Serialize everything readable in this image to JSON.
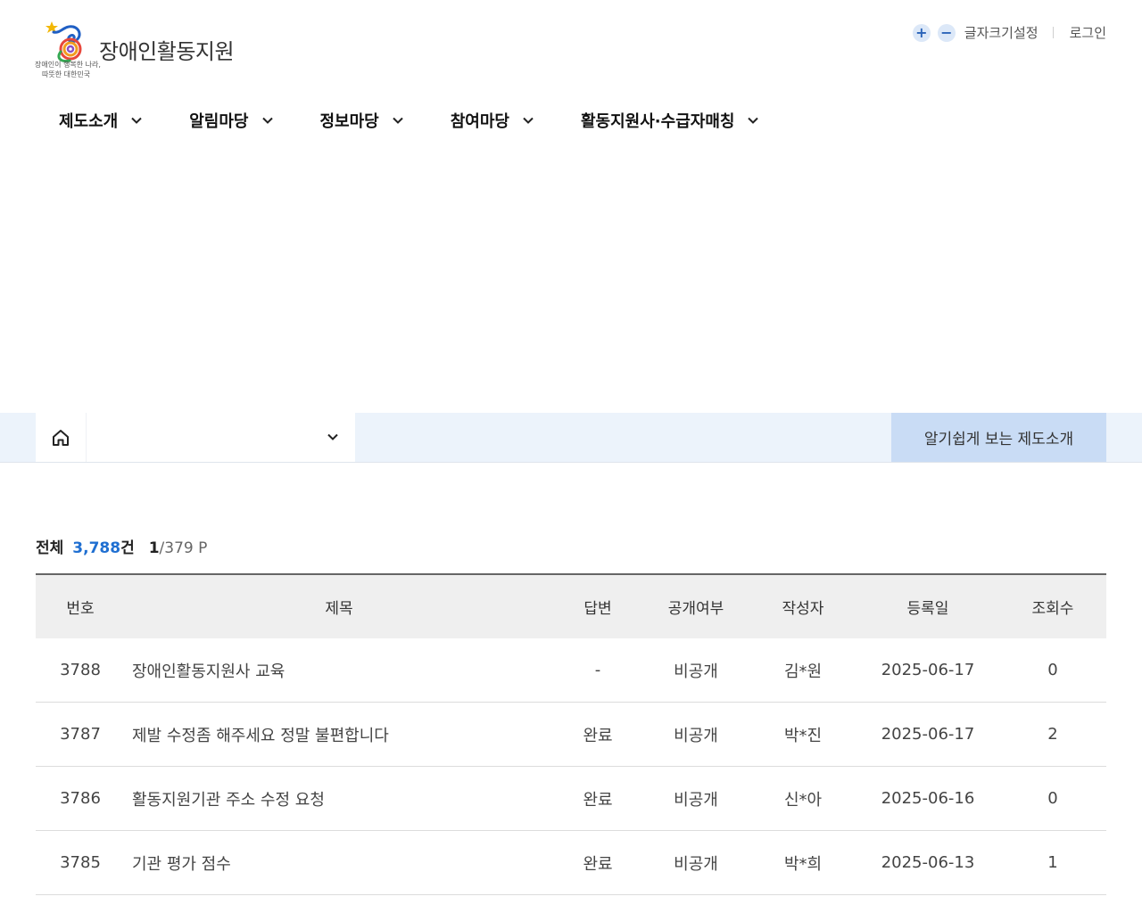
{
  "header": {
    "site_title": "장애인활동지원",
    "logo_caption_line1": "장애인이 행복한 나라,",
    "logo_caption_line2": "따뜻한 대한민국",
    "util": {
      "zoom_in": "+",
      "zoom_out": "−",
      "font_setting": "글자크기설정",
      "login": "로그인"
    }
  },
  "gnb": [
    {
      "label": "제도소개"
    },
    {
      "label": "알림마당"
    },
    {
      "label": "정보마당"
    },
    {
      "label": "참여마당"
    },
    {
      "label": "활동지원사·수급자매칭"
    }
  ],
  "location": {
    "selected": "",
    "easy_button": "알기쉽게 보는 제도소개"
  },
  "board": {
    "summary": {
      "total_label": "전체",
      "total_count": "3,788",
      "count_unit": "건",
      "current_page": "1",
      "total_pages": "/379 P"
    },
    "headers": {
      "no": "번호",
      "title": "제목",
      "answer": "답변",
      "public": "공개여부",
      "author": "작성자",
      "date": "등록일",
      "views": "조회수"
    },
    "rows": [
      {
        "no": "3788",
        "title": "장애인활동지원사 교육",
        "answer": "-",
        "public": "비공개",
        "author": "김*원",
        "date": "2025-06-17",
        "views": "0"
      },
      {
        "no": "3787",
        "title": "제발 수정좀 해주세요 정말 불편합니다",
        "answer": "완료",
        "public": "비공개",
        "author": "박*진",
        "date": "2025-06-17",
        "views": "2"
      },
      {
        "no": "3786",
        "title": "활동지원기관 주소 수정 요청",
        "answer": "완료",
        "public": "비공개",
        "author": "신*아",
        "date": "2025-06-16",
        "views": "0"
      },
      {
        "no": "3785",
        "title": "기관 평가 점수",
        "answer": "완료",
        "public": "비공개",
        "author": "박*희",
        "date": "2025-06-13",
        "views": "1"
      }
    ]
  },
  "icons": {
    "logo": "spiral-logo-icon",
    "chevron": "chevron-down-icon",
    "home": "home-icon"
  },
  "colors": {
    "accent_blue": "#1f6fd1",
    "locbar_bg": "#ecf3fb",
    "easy_button_bg": "#c9dcf5",
    "table_header_bg": "#efefef"
  }
}
